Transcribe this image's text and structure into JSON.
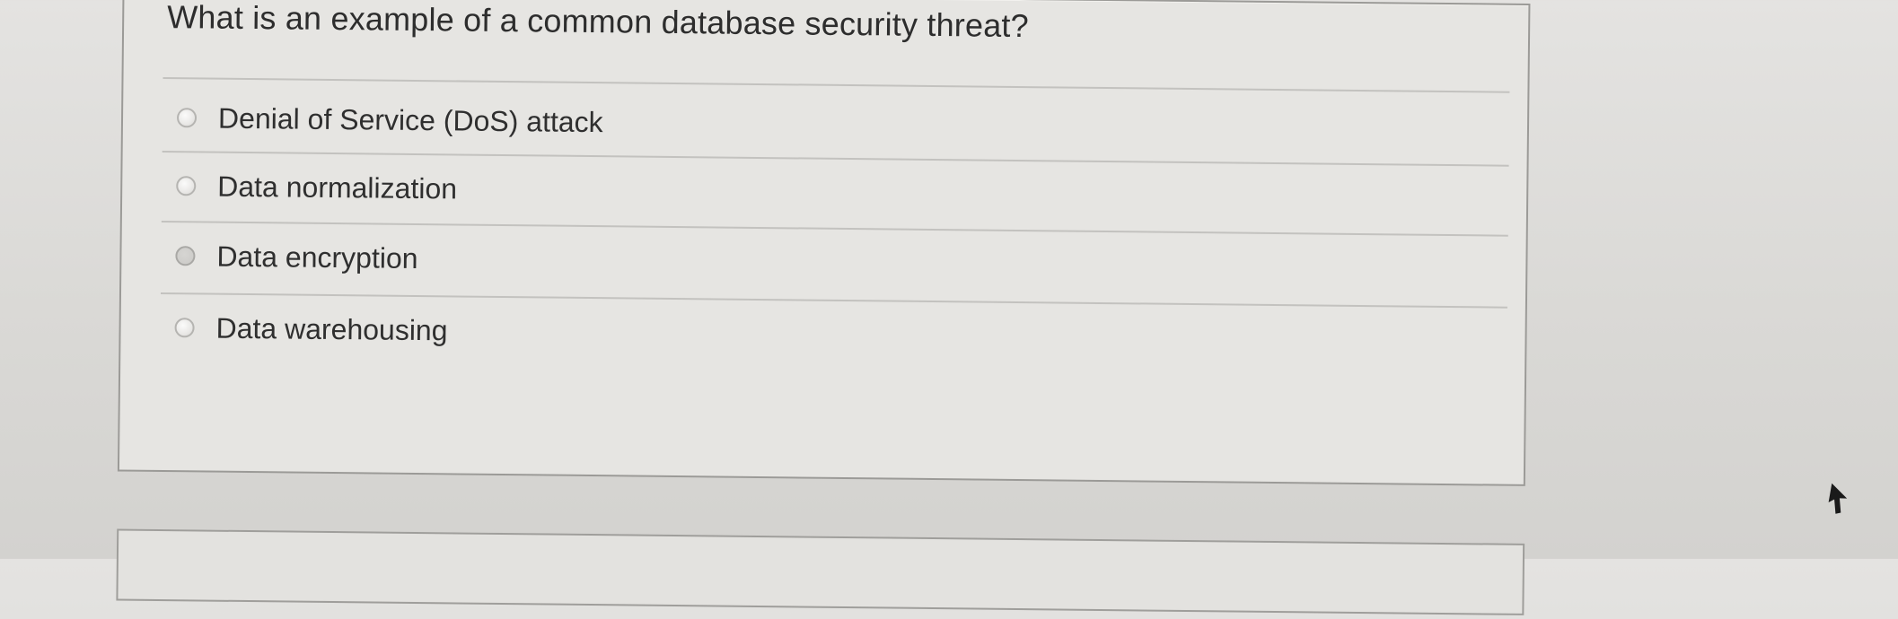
{
  "question": {
    "text": "What is an example of a common database security threat?"
  },
  "options": [
    {
      "label": "Denial of Service (DoS) attack",
      "selected": false
    },
    {
      "label": "Data normalization",
      "selected": false
    },
    {
      "label": "Data encryption",
      "selected": false
    },
    {
      "label": "Data warehousing",
      "selected": false
    }
  ],
  "icons": {
    "radio": "radio-button-icon",
    "cursor": "mouse-pointer-icon"
  }
}
